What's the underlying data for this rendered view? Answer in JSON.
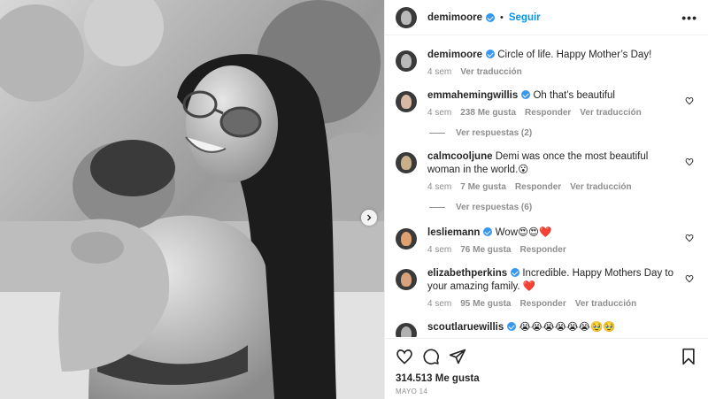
{
  "post": {
    "author": "demimoore",
    "follow_label": "Seguir",
    "dot": "•",
    "more": "•••"
  },
  "caption": {
    "author": "demimoore",
    "text": "Circle of life. Happy Mother’s Day!",
    "time": "4 sem",
    "translate": "Ver traducción"
  },
  "comments": [
    {
      "user": "emmahemingwillis",
      "verified": true,
      "text": "Oh that’s beautiful",
      "time": "4 sem",
      "likes": "238 Me gusta",
      "reply": "Responder",
      "translate": "Ver traducción",
      "view_replies": "Ver respuestas (2)"
    },
    {
      "user": "calmcooljune",
      "verified": false,
      "text": "Demi was once the most beautiful woman in the world.😮",
      "time": "4 sem",
      "likes": "7 Me gusta",
      "reply": "Responder",
      "translate": "Ver traducción",
      "view_replies": "Ver respuestas (6)"
    },
    {
      "user": "lesliemann",
      "verified": true,
      "text": "Wow😍😍❤️",
      "time": "4 sem",
      "likes": "76 Me gusta",
      "reply": "Responder"
    },
    {
      "user": "elizabethperkins",
      "verified": true,
      "text": "Incredible. Happy Mothers Day to your amazing family. ❤️",
      "time": "4 sem",
      "likes": "95 Me gusta",
      "reply": "Responder",
      "translate": "Ver traducción"
    },
    {
      "user": "scoutlaruewillis",
      "verified": true,
      "text": "😭😭😭😭😭😭🥹🥹"
    }
  ],
  "footer": {
    "likes": "314.513 Me gusta",
    "date": "MAYO 14"
  },
  "icons": {
    "like": "heart-icon",
    "comment": "comment-icon",
    "share": "send-icon",
    "save": "bookmark-icon",
    "next": "chevron-right-icon"
  },
  "colors": {
    "accent": "#0095f6",
    "verified": "#3897f0",
    "muted": "#8e8e8e"
  }
}
